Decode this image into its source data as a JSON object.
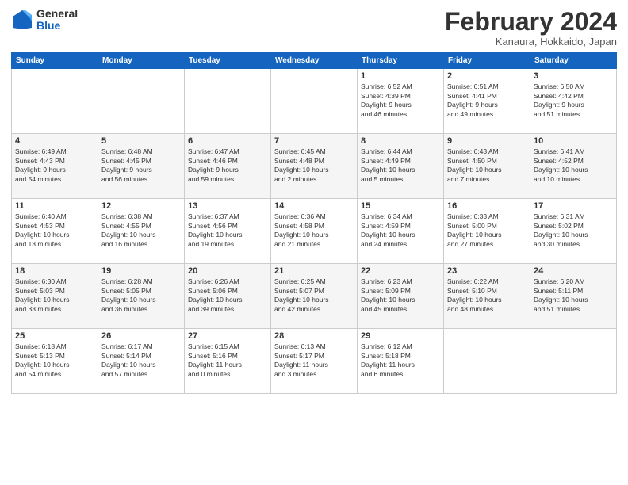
{
  "logo": {
    "general": "General",
    "blue": "Blue"
  },
  "title": "February 2024",
  "location": "Kanaura, Hokkaido, Japan",
  "days_of_week": [
    "Sunday",
    "Monday",
    "Tuesday",
    "Wednesday",
    "Thursday",
    "Friday",
    "Saturday"
  ],
  "weeks": [
    [
      {
        "day": "",
        "info": ""
      },
      {
        "day": "",
        "info": ""
      },
      {
        "day": "",
        "info": ""
      },
      {
        "day": "",
        "info": ""
      },
      {
        "day": "1",
        "info": "Sunrise: 6:52 AM\nSunset: 4:39 PM\nDaylight: 9 hours\nand 46 minutes."
      },
      {
        "day": "2",
        "info": "Sunrise: 6:51 AM\nSunset: 4:41 PM\nDaylight: 9 hours\nand 49 minutes."
      },
      {
        "day": "3",
        "info": "Sunrise: 6:50 AM\nSunset: 4:42 PM\nDaylight: 9 hours\nand 51 minutes."
      }
    ],
    [
      {
        "day": "4",
        "info": "Sunrise: 6:49 AM\nSunset: 4:43 PM\nDaylight: 9 hours\nand 54 minutes."
      },
      {
        "day": "5",
        "info": "Sunrise: 6:48 AM\nSunset: 4:45 PM\nDaylight: 9 hours\nand 56 minutes."
      },
      {
        "day": "6",
        "info": "Sunrise: 6:47 AM\nSunset: 4:46 PM\nDaylight: 9 hours\nand 59 minutes."
      },
      {
        "day": "7",
        "info": "Sunrise: 6:45 AM\nSunset: 4:48 PM\nDaylight: 10 hours\nand 2 minutes."
      },
      {
        "day": "8",
        "info": "Sunrise: 6:44 AM\nSunset: 4:49 PM\nDaylight: 10 hours\nand 5 minutes."
      },
      {
        "day": "9",
        "info": "Sunrise: 6:43 AM\nSunset: 4:50 PM\nDaylight: 10 hours\nand 7 minutes."
      },
      {
        "day": "10",
        "info": "Sunrise: 6:41 AM\nSunset: 4:52 PM\nDaylight: 10 hours\nand 10 minutes."
      }
    ],
    [
      {
        "day": "11",
        "info": "Sunrise: 6:40 AM\nSunset: 4:53 PM\nDaylight: 10 hours\nand 13 minutes."
      },
      {
        "day": "12",
        "info": "Sunrise: 6:38 AM\nSunset: 4:55 PM\nDaylight: 10 hours\nand 16 minutes."
      },
      {
        "day": "13",
        "info": "Sunrise: 6:37 AM\nSunset: 4:56 PM\nDaylight: 10 hours\nand 19 minutes."
      },
      {
        "day": "14",
        "info": "Sunrise: 6:36 AM\nSunset: 4:58 PM\nDaylight: 10 hours\nand 21 minutes."
      },
      {
        "day": "15",
        "info": "Sunrise: 6:34 AM\nSunset: 4:59 PM\nDaylight: 10 hours\nand 24 minutes."
      },
      {
        "day": "16",
        "info": "Sunrise: 6:33 AM\nSunset: 5:00 PM\nDaylight: 10 hours\nand 27 minutes."
      },
      {
        "day": "17",
        "info": "Sunrise: 6:31 AM\nSunset: 5:02 PM\nDaylight: 10 hours\nand 30 minutes."
      }
    ],
    [
      {
        "day": "18",
        "info": "Sunrise: 6:30 AM\nSunset: 5:03 PM\nDaylight: 10 hours\nand 33 minutes."
      },
      {
        "day": "19",
        "info": "Sunrise: 6:28 AM\nSunset: 5:05 PM\nDaylight: 10 hours\nand 36 minutes."
      },
      {
        "day": "20",
        "info": "Sunrise: 6:26 AM\nSunset: 5:06 PM\nDaylight: 10 hours\nand 39 minutes."
      },
      {
        "day": "21",
        "info": "Sunrise: 6:25 AM\nSunset: 5:07 PM\nDaylight: 10 hours\nand 42 minutes."
      },
      {
        "day": "22",
        "info": "Sunrise: 6:23 AM\nSunset: 5:09 PM\nDaylight: 10 hours\nand 45 minutes."
      },
      {
        "day": "23",
        "info": "Sunrise: 6:22 AM\nSunset: 5:10 PM\nDaylight: 10 hours\nand 48 minutes."
      },
      {
        "day": "24",
        "info": "Sunrise: 6:20 AM\nSunset: 5:11 PM\nDaylight: 10 hours\nand 51 minutes."
      }
    ],
    [
      {
        "day": "25",
        "info": "Sunrise: 6:18 AM\nSunset: 5:13 PM\nDaylight: 10 hours\nand 54 minutes."
      },
      {
        "day": "26",
        "info": "Sunrise: 6:17 AM\nSunset: 5:14 PM\nDaylight: 10 hours\nand 57 minutes."
      },
      {
        "day": "27",
        "info": "Sunrise: 6:15 AM\nSunset: 5:16 PM\nDaylight: 11 hours\nand 0 minutes."
      },
      {
        "day": "28",
        "info": "Sunrise: 6:13 AM\nSunset: 5:17 PM\nDaylight: 11 hours\nand 3 minutes."
      },
      {
        "day": "29",
        "info": "Sunrise: 6:12 AM\nSunset: 5:18 PM\nDaylight: 11 hours\nand 6 minutes."
      },
      {
        "day": "",
        "info": ""
      },
      {
        "day": "",
        "info": ""
      }
    ]
  ]
}
